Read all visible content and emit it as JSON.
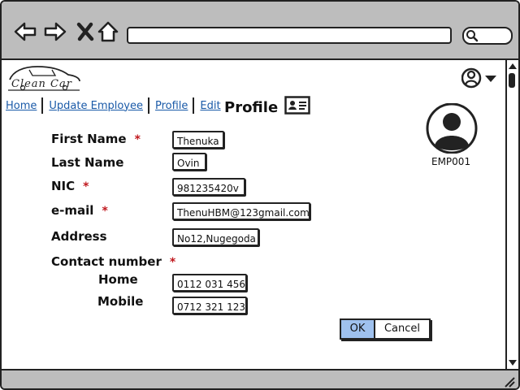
{
  "browser": {
    "back_icon": "arrow-left-icon",
    "forward_icon": "arrow-right-icon",
    "close_icon": "close-icon",
    "home_icon": "home-icon",
    "search_icon": "search-icon"
  },
  "app": {
    "logo_text": "Clean  Car"
  },
  "breadcrumb": [
    {
      "label": "Home"
    },
    {
      "label": "Update Employee"
    },
    {
      "label": "Profile"
    },
    {
      "label": "Edit"
    }
  ],
  "page": {
    "title": "Profile",
    "employee_id": "EMP001"
  },
  "form": {
    "required_mark": "*",
    "first_name": {
      "label": "First Name",
      "value": "Thenuka"
    },
    "last_name": {
      "label": "Last Name",
      "value": "Ovin"
    },
    "nic": {
      "label": "NIC",
      "value": "981235420v"
    },
    "email": {
      "label": "e-mail",
      "value": "ThenuHBM@123gmail.com"
    },
    "address": {
      "label": "Address",
      "value": "No12,Nugegoda"
    },
    "contact": {
      "label": "Contact number",
      "home": {
        "label": "Home",
        "value": "0112 031 456"
      },
      "mobile": {
        "label": "Mobile",
        "value": "0712 321 123"
      }
    }
  },
  "buttons": {
    "ok": "OK",
    "cancel": "Cancel"
  },
  "colors": {
    "chrome": "#bdbdbd",
    "link": "#1a5aa8",
    "required": "#c0171d",
    "ok_button": "#9fc1ee"
  }
}
